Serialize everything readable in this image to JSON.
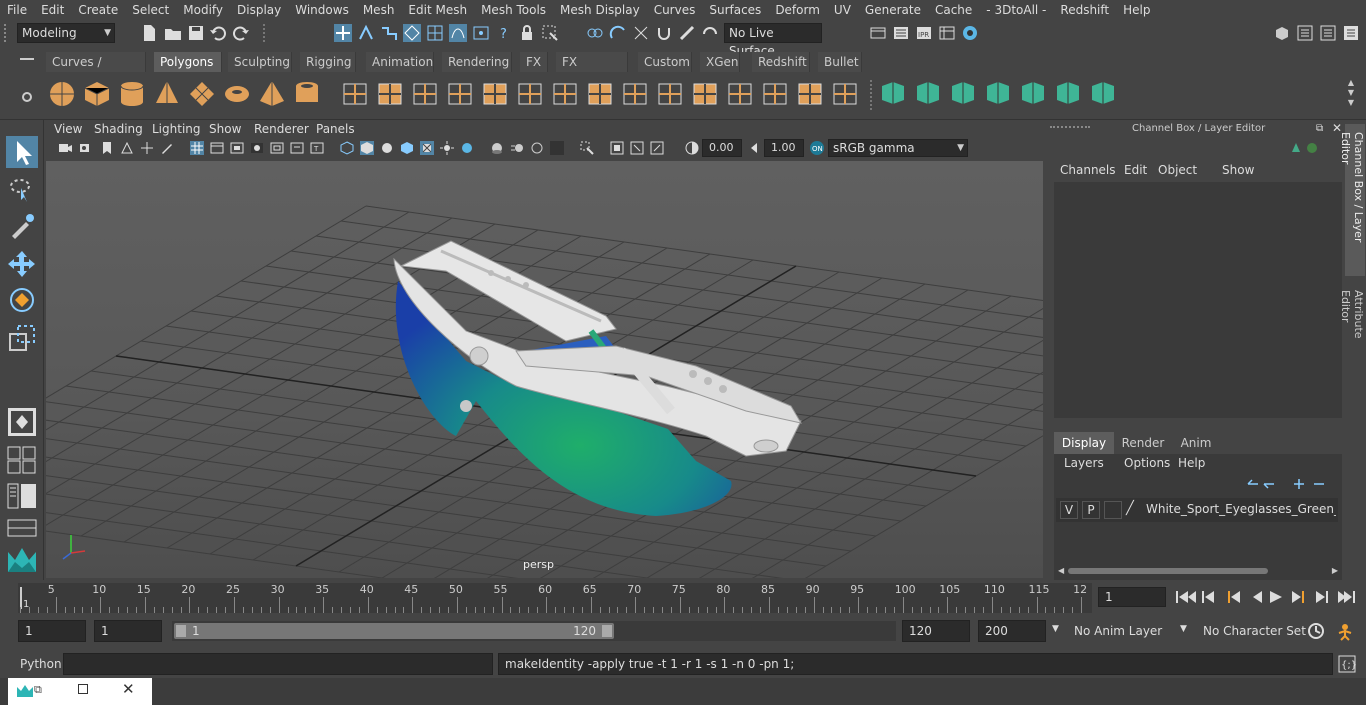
{
  "menu": [
    "File",
    "Edit",
    "Create",
    "Select",
    "Modify",
    "Display",
    "Windows",
    "Mesh",
    "Edit Mesh",
    "Mesh Tools",
    "Mesh Display",
    "Curves",
    "Surfaces",
    "Deform",
    "UV",
    "Generate",
    "Cache",
    "- 3DtoAll -",
    "Redshift",
    "Help"
  ],
  "status": {
    "mode": "Modeling",
    "live_surface": "No Live Surface"
  },
  "shelf_tabs": [
    "Curves / Surfaces",
    "Polygons",
    "Sculpting",
    "Rigging",
    "Animation",
    "Rendering",
    "FX",
    "FX Caching",
    "Custom",
    "XGen",
    "Redshift",
    "Bullet"
  ],
  "shelf_active": "Polygons",
  "viewport": {
    "menu": [
      "View",
      "Shading",
      "Lighting",
      "Show",
      "Renderer",
      "Panels"
    ],
    "exposure": "0.00",
    "gamma": "1.00",
    "colorspace": "sRGB gamma",
    "camera_label": "persp"
  },
  "channel_box": {
    "title": "Channel Box / Layer Editor",
    "menu": [
      "Channels",
      "Edit",
      "Object",
      "Show"
    ],
    "side_tabs": [
      "Channel Box / Layer Editor",
      "Attribute Editor"
    ]
  },
  "layers": {
    "tabs": [
      "Display",
      "Render",
      "Anim"
    ],
    "active_tab": "Display",
    "menu": [
      "Layers",
      "Options",
      "Help"
    ],
    "row": {
      "v": "V",
      "p": "P",
      "name": "White_Sport_Eyeglasses_Green_Glass"
    }
  },
  "timeline": {
    "ticks": [
      "5",
      "10",
      "15",
      "20",
      "25",
      "30",
      "35",
      "40",
      "45",
      "50",
      "55",
      "60",
      "65",
      "70",
      "75",
      "80",
      "85",
      "90",
      "95",
      "100",
      "105",
      "110",
      "115",
      "12"
    ],
    "current_marker": "1",
    "current_frame": "1"
  },
  "range": {
    "start": "1",
    "playback_start": "1",
    "slider_start": "1",
    "slider_end": "120",
    "playback_end": "120",
    "end": "200",
    "anim_layer": "No Anim Layer",
    "char_set": "No Character Set"
  },
  "command": {
    "lang": "Python",
    "result": "makeIdentity -apply true -t 1 -r 1 -s 1 -n 0 -pn 1;"
  },
  "colors": {
    "accent": "#5285a6",
    "shelf_orange": "#e0a05a",
    "shelf_green": "#3fb596",
    "lens_green": "#1fae6a",
    "lens_blue": "#1a3fa8",
    "frame_white": "#e6e6e6"
  }
}
